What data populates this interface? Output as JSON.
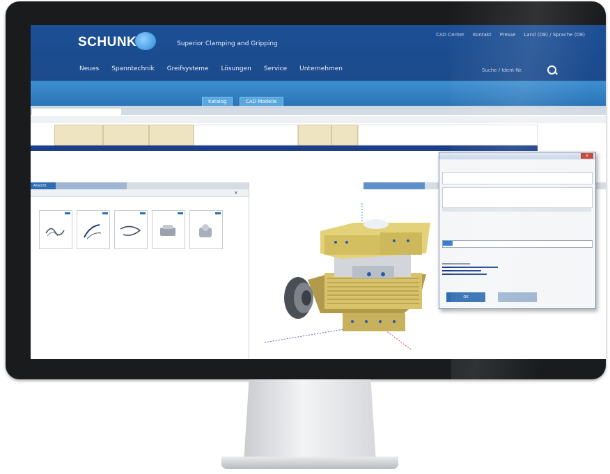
{
  "header": {
    "logo_text": "SCHUNK",
    "tagline": "Superior Clamping and Gripping",
    "top_links": [
      "CAD Center",
      "Kontakt",
      "Presse",
      "Land (DE) / Sprache (DE)"
    ],
    "nav": [
      "Neues",
      "Spanntechnik",
      "Greifsysteme",
      "Lösungen",
      "Service",
      "Unternehmen"
    ],
    "search_placeholder": "Suche / Ident-Nr."
  },
  "band_buttons": [
    "Katalog",
    "CAD Modelle"
  ],
  "app": {
    "doc_tab": "",
    "subtabs": "",
    "row_label": "",
    "selected_row_text": ""
  },
  "left_pane": {
    "tabs": [
      "Ansicht",
      "",
      ""
    ],
    "breadcrumb": "",
    "cards": [
      "",
      "",
      "",
      "",
      ""
    ]
  },
  "right_pane": {
    "tabs": [
      "",
      ""
    ]
  },
  "dialog": {
    "title": "",
    "close": "x",
    "ok_label": "OK",
    "cancel_label": ""
  },
  "colors": {
    "brand_blue": "#1b4a8c",
    "band_blue": "#2b74b8",
    "table_header": "#efe4c2",
    "selection": "#1d3f8a"
  }
}
